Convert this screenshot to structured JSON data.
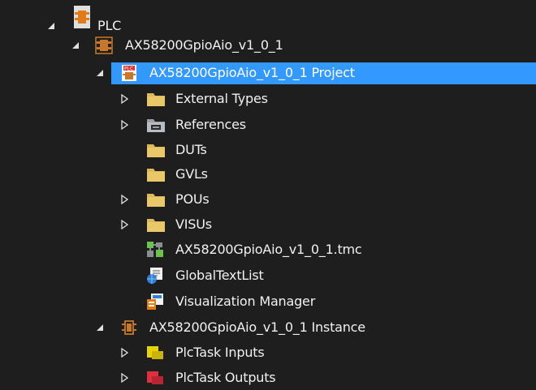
{
  "tree": {
    "colors": {
      "background": "#1e1e1e",
      "selection": "#3399ff",
      "text": "#f1f1f1",
      "folder": "#dcb85a",
      "plc_orange": "#c8782a",
      "inputs_yellow": "#e8d20a",
      "outputs_red": "#e03040"
    },
    "nodes": [
      {
        "label": "PLC",
        "expander": "expanded",
        "icon": "plc-root-icon"
      },
      {
        "label": "AX58200GpioAio_v1_0_1",
        "expander": "expanded",
        "icon": "plc-module-icon"
      },
      {
        "label": "AX58200GpioAio_v1_0_1 Project",
        "expander": "expanded",
        "icon": "plc-project-icon",
        "selected": true
      },
      {
        "label": "External Types",
        "expander": "collapsed",
        "icon": "folder-icon"
      },
      {
        "label": "References",
        "expander": "collapsed",
        "icon": "references-icon"
      },
      {
        "label": "DUTs",
        "expander": "none",
        "icon": "folder-icon"
      },
      {
        "label": "GVLs",
        "expander": "none",
        "icon": "folder-icon"
      },
      {
        "label": "POUs",
        "expander": "collapsed",
        "icon": "folder-icon"
      },
      {
        "label": "VISUs",
        "expander": "collapsed",
        "icon": "folder-icon"
      },
      {
        "label": "AX58200GpioAio_v1_0_1.tmc",
        "expander": "none",
        "icon": "tmc-file-icon"
      },
      {
        "label": "GlobalTextList",
        "expander": "none",
        "icon": "global-text-list-icon"
      },
      {
        "label": "Visualization Manager",
        "expander": "none",
        "icon": "visualization-manager-icon"
      },
      {
        "label": "AX58200GpioAio_v1_0_1 Instance",
        "expander": "expanded",
        "icon": "plc-instance-icon"
      },
      {
        "label": "PlcTask Inputs",
        "expander": "collapsed",
        "icon": "inputs-icon"
      },
      {
        "label": "PlcTask Outputs",
        "expander": "collapsed",
        "icon": "outputs-icon"
      }
    ]
  }
}
